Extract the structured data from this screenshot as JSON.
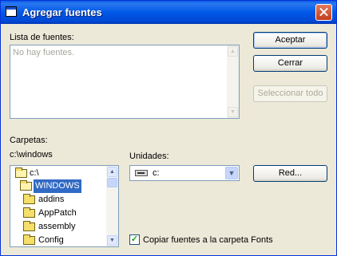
{
  "window": {
    "title": "Agregar fuentes",
    "close_glyph": "close-icon"
  },
  "fonts_list": {
    "label": "Lista de fuentes:",
    "placeholder": "No hay fuentes."
  },
  "buttons": {
    "accept": "Aceptar",
    "close": "Cerrar",
    "select_all": "Seleccionar todo",
    "network": "Red..."
  },
  "folders": {
    "label": "Carpetas:",
    "path": "c:\\windows",
    "items": [
      {
        "name": "c:\\",
        "icon": "folder-open-icon"
      },
      {
        "name": "WINDOWS",
        "icon": "folder-open-icon"
      },
      {
        "name": "addins",
        "icon": "folder-icon"
      },
      {
        "name": "AppPatch",
        "icon": "folder-icon"
      },
      {
        "name": "assembly",
        "icon": "folder-icon"
      },
      {
        "name": "Config",
        "icon": "folder-icon"
      }
    ]
  },
  "drives": {
    "label": "Unidades:",
    "selected": "c:"
  },
  "copy_option": {
    "label": "Copiar fuentes a la carpeta Fonts",
    "checked": true
  },
  "colors": {
    "title_bar": "#0058e6",
    "dialog_bg": "#ece9d8",
    "selection": "#316ac5"
  }
}
